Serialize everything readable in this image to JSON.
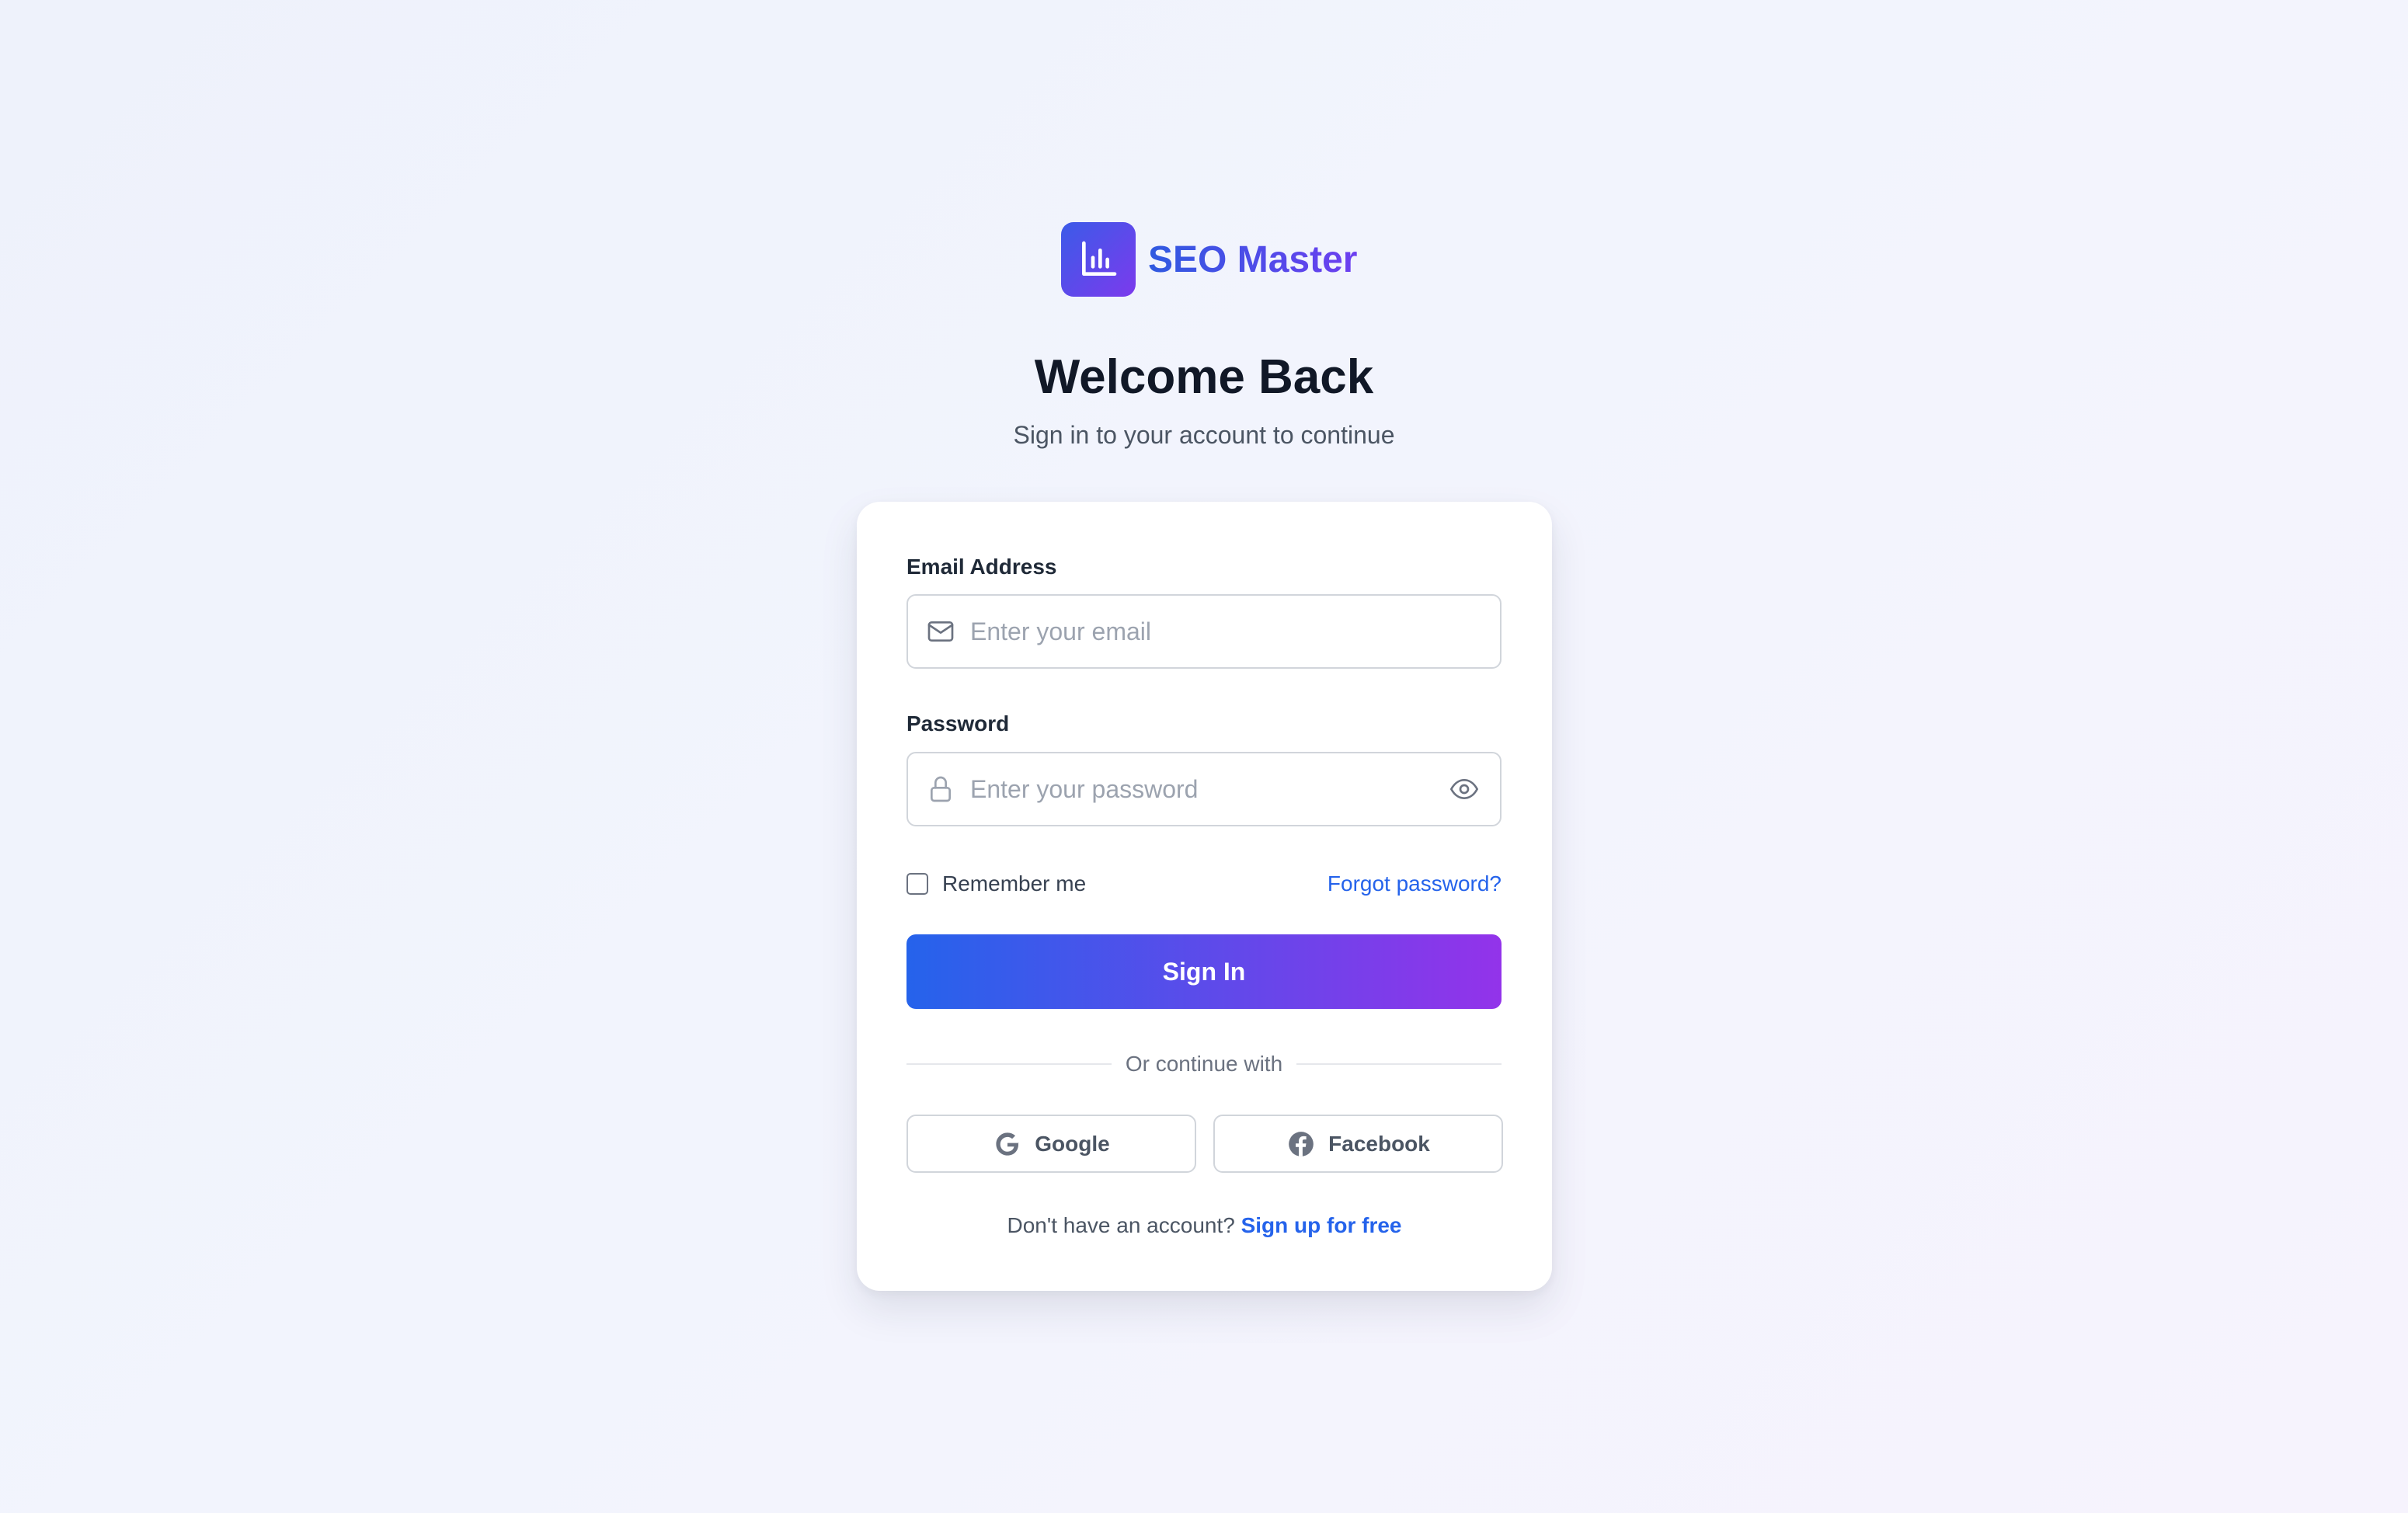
{
  "brand": {
    "name": "SEO Master",
    "logo_icon": "bar-chart-icon",
    "gradient_start": "#3b5be8",
    "gradient_end": "#7c3aed"
  },
  "header": {
    "title": "Welcome Back",
    "subtitle": "Sign in to your account to continue"
  },
  "form": {
    "email": {
      "label": "Email Address",
      "placeholder": "Enter your email",
      "value": "",
      "icon": "mail-icon"
    },
    "password": {
      "label": "Password",
      "placeholder": "Enter your password",
      "value": "",
      "icon": "lock-icon",
      "toggle_icon": "eye-icon"
    },
    "remember_me": {
      "label": "Remember me",
      "checked": false
    },
    "forgot_password": "Forgot password?",
    "submit_label": "Sign In",
    "divider_text": "Or continue with",
    "social": [
      {
        "label": "Google",
        "icon": "google-icon"
      },
      {
        "label": "Facebook",
        "icon": "facebook-icon"
      }
    ],
    "signup": {
      "prompt": "Don't have an account?",
      "link": "Sign up for free"
    }
  },
  "colors": {
    "accent": "#2563eb",
    "button_gradient_start": "#2563eb",
    "button_gradient_end": "#9333ea"
  }
}
